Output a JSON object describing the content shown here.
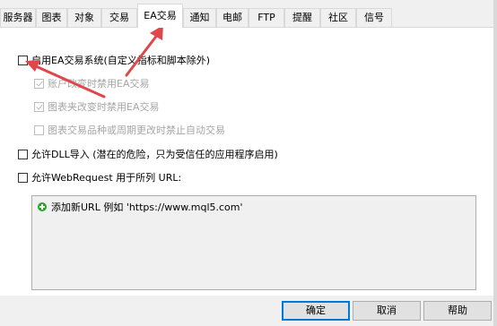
{
  "tabs": [
    {
      "label": "服务器"
    },
    {
      "label": "图表"
    },
    {
      "label": "对象"
    },
    {
      "label": "交易"
    },
    {
      "label": "EA交易"
    },
    {
      "label": "通知"
    },
    {
      "label": "电邮"
    },
    {
      "label": "FTP"
    },
    {
      "label": "提醒"
    },
    {
      "label": "社区"
    },
    {
      "label": "信号"
    }
  ],
  "active_tab": "EA交易",
  "options": {
    "enable_ea": {
      "label": "启用EA交易系统(自定义指标和脚本除外)",
      "checked": false
    },
    "disable_on_account_change": {
      "label": "账户改变时禁用EA交易",
      "checked": true,
      "disabled": true
    },
    "disable_on_profile_change": {
      "label": "图表夹改变时禁用EA交易",
      "checked": true,
      "disabled": true
    },
    "disable_on_symbol_change": {
      "label": "图表交易品种或周期更改时禁止自动交易",
      "checked": false,
      "disabled": true
    },
    "allow_dll": {
      "label": "允许DLL导入 (潜在的危险，只为受信任的应用程序启用)",
      "checked": false
    },
    "allow_webrequest": {
      "label": "允许WebRequest 用于所列 URL:",
      "checked": false
    }
  },
  "url_list": {
    "add_item_label": "添加新URL 例如 'https://www.mql5.com'",
    "add_icon": "plus-circle-icon"
  },
  "buttons": {
    "ok": "确定",
    "cancel": "取消",
    "help": "帮助"
  },
  "colors": {
    "annotation_arrow": "#e0474c",
    "default_button_border": "#0078d7",
    "add_icon": "#2aa52a"
  }
}
